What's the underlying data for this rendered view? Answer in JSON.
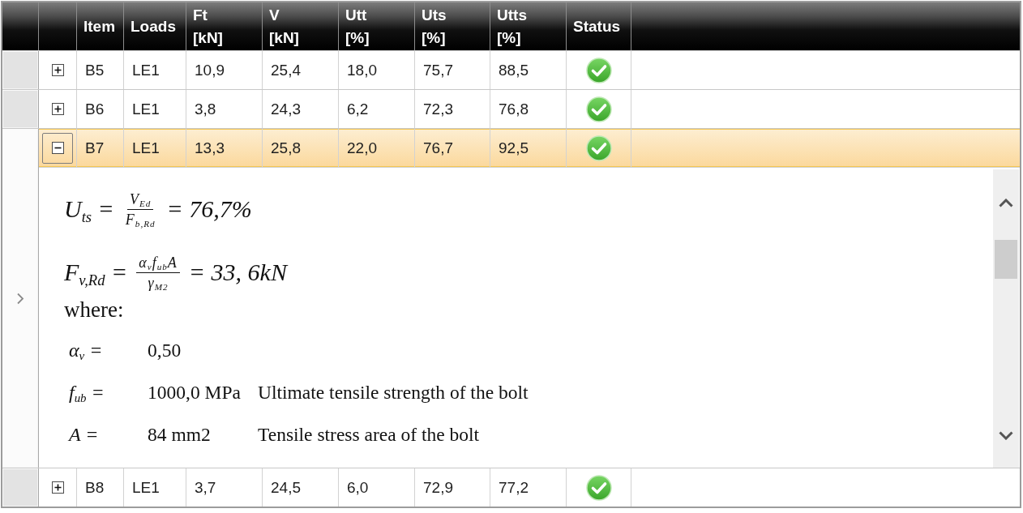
{
  "columns": [
    {
      "label": "Item"
    },
    {
      "label": "Loads"
    },
    {
      "label": "Ft",
      "unit": "[kN]"
    },
    {
      "label": "V",
      "unit": "[kN]"
    },
    {
      "label": "Utt",
      "unit": "[%]"
    },
    {
      "label": "Uts",
      "unit": "[%]"
    },
    {
      "label": "Utts",
      "unit": "[%]"
    },
    {
      "label": "Status"
    }
  ],
  "rows": [
    {
      "item": "B5",
      "loads": "LE1",
      "values": [
        "10,9",
        "25,4",
        "18,0",
        "75,7",
        "88,5"
      ],
      "status": {
        "kind": "ok"
      },
      "expanded": false,
      "selected": false
    },
    {
      "item": "B6",
      "loads": "LE1",
      "values": [
        "3,8",
        "24,3",
        "6,2",
        "72,3",
        "76,8"
      ],
      "status": {
        "kind": "ok"
      },
      "expanded": false,
      "selected": false
    },
    {
      "item": "B7",
      "loads": "LE1",
      "values": [
        "13,3",
        "25,8",
        "22,0",
        "76,7",
        "92,5"
      ],
      "status": {
        "kind": "ok"
      },
      "expanded": true,
      "selected": true,
      "detail": {
        "formulas": [
          {
            "symbol": "U$_{ts}$ =",
            "numerator": "V$_{Ed}$",
            "denominator": "F$_{b,Rd}$",
            "result": "= 76,7%"
          },
          {
            "symbol": "F$_{v,Rd}$ =",
            "numerator": "α$_{v}$f$_{ub}$A",
            "denominator": "γ$_{M2}$",
            "result": "= 33, 6kN"
          }
        ],
        "where": "where:",
        "parameters": [
          {
            "symbol": "α$_{v}$ =",
            "value": "0,50"
          },
          {
            "symbol": "f$_{ub}$ =",
            "value": "1000,0 MPa",
            "description": "Ultimate tensile strength of the bolt"
          },
          {
            "symbol": "A =",
            "value": "84 mm2",
            "description": "Tensile stress area of the bolt"
          }
        ]
      }
    },
    {
      "item": "B8",
      "loads": "LE1",
      "values": [
        "3,7",
        "24,5",
        "6,0",
        "72,9",
        "77,2"
      ],
      "status": {
        "kind": "ok"
      },
      "expanded": false,
      "selected": false
    }
  ]
}
